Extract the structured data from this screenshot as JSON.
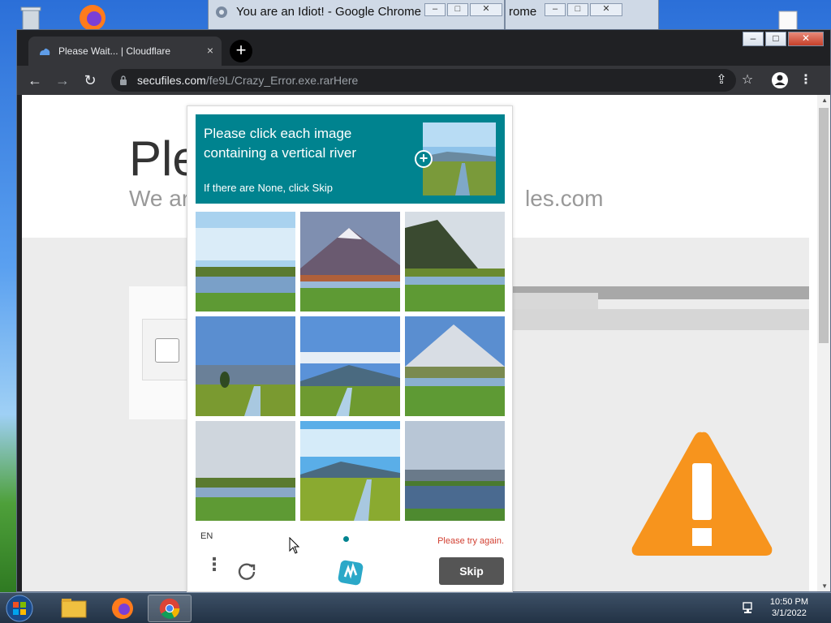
{
  "bg_windows": [
    {
      "title": "You are an Idiot! - Google Chrome"
    },
    {
      "title": "rome"
    }
  ],
  "browser": {
    "tab_title": "Please Wait... | Cloudflare",
    "tab_close": "×",
    "new_tab": "+",
    "url_host": "secufiles.com",
    "url_path": "/fe9L/Crazy_Error.exe.rarHere"
  },
  "page": {
    "title": "Ple",
    "subtitle_left": "We ar",
    "subtitle_right": "les.com"
  },
  "captcha": {
    "instruction": "Please click each image containing a vertical river",
    "hint": "If there are None, click Skip",
    "language": "EN",
    "error": "Please try again.",
    "skip_label": "Skip",
    "menu": "⋮",
    "tiles": [
      {
        "type": "river-horizontal"
      },
      {
        "type": "mountain-river"
      },
      {
        "type": "hill-river"
      },
      {
        "type": "vertical-river"
      },
      {
        "type": "vertical-river"
      },
      {
        "type": "snow-mountain-river"
      },
      {
        "type": "cloudy-river"
      },
      {
        "type": "vertical-river"
      },
      {
        "type": "lake"
      }
    ]
  },
  "taskbar": {
    "time": "10:50 PM",
    "date": "3/1/2022",
    "apps": [
      "file-explorer",
      "firefox",
      "chrome"
    ]
  },
  "colors": {
    "captcha_teal": "#00838f",
    "skip_button": "#555555",
    "warning_orange": "#f7941d",
    "chrome_dark": "#35363a"
  }
}
